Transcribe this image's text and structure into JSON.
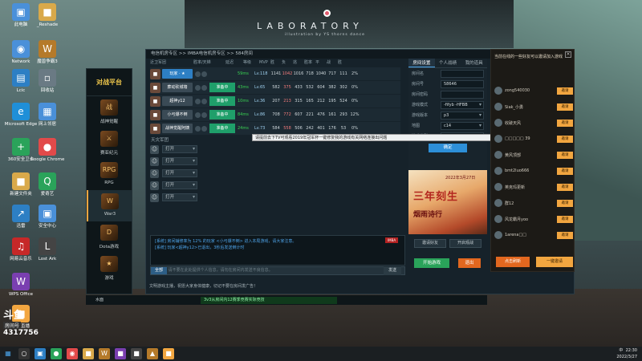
{
  "desktop": {
    "banner_title": "LABORATORY",
    "banner_subtitle": "illustration by YS thorns dance",
    "icons": [
      {
        "label": "此电脑",
        "glyph": "▣",
        "color": "#4a90d9"
      },
      {
        "label": "_Reshade",
        "glyph": "■",
        "color": "#d9a94a"
      },
      {
        "label": "Network",
        "glyph": "◉",
        "color": "#4a90d9"
      },
      {
        "label": "魔兽争霸3",
        "glyph": "W",
        "color": "#b57a2a"
      },
      {
        "label": "Lcic",
        "glyph": "▤",
        "color": "#2d7fc4"
      },
      {
        "label": "回收站",
        "glyph": "▫",
        "color": "#6a7a84"
      },
      {
        "label": "Microsoft Edge",
        "glyph": "e",
        "color": "#1f8fd8"
      },
      {
        "label": "网上邻居",
        "glyph": "▦",
        "color": "#4a90d9"
      },
      {
        "label": "360安全卫士",
        "glyph": "+",
        "color": "#2aa35a"
      },
      {
        "label": "Google Chrome",
        "glyph": "●",
        "color": "#e24a4a"
      },
      {
        "label": "新建文件夹",
        "glyph": "■",
        "color": "#d9a94a"
      },
      {
        "label": "爱奇艺",
        "glyph": "Q",
        "color": "#2aa35a"
      },
      {
        "label": "迅雷",
        "glyph": "↗",
        "color": "#2d7fc4"
      },
      {
        "label": "安全中心",
        "glyph": "▣",
        "color": "#4a90d9"
      },
      {
        "label": "网易云音乐",
        "glyph": "♫",
        "color": "#c62828"
      },
      {
        "label": "Lost Ark",
        "glyph": "L",
        "color": "#444"
      },
      {
        "label": "WPS Office",
        "glyph": "W",
        "color": "#7a3fb0"
      },
      {
        "label": "斗鱼直播",
        "glyph": "■",
        "color": "#f2a640"
      }
    ]
  },
  "sidebar": {
    "logo": "对战平台",
    "items": [
      {
        "label": "战神觉醒",
        "icon": "战"
      },
      {
        "label": "赛亚纪元",
        "icon": "⚔"
      },
      {
        "label": "RPG",
        "icon": "RPG"
      },
      {
        "label": "War3",
        "icon": "W"
      },
      {
        "label": "Dota游戏",
        "icon": "D"
      },
      {
        "label": "游戏",
        "icon": "★"
      }
    ]
  },
  "room": {
    "breadcrumb": "电信机房专区 >> IMBA电信机房专区 >> 584房间",
    "team1_label": "近卫军团",
    "team2_label": "天灾军团",
    "columns": [
      "近卫军团",
      "胜率/天梯",
      "延迟",
      "等级",
      "MVP",
      "胜",
      "负",
      "逃",
      "胜率",
      "平",
      "战",
      "胜"
    ],
    "players": [
      {
        "avatar": "■",
        "name": "玩家 · ★",
        "me": true,
        "badge": "",
        "ping": "59ms",
        "level": "Lv.118",
        "stats": [
          "1141",
          "1042",
          "1016",
          "718",
          "1040",
          "717",
          "111",
          "2%"
        ]
      },
      {
        "avatar": "■",
        "name": "葬动砍城墙",
        "me": false,
        "badge": "准备中",
        "ping": "43ms",
        "level": "Lv.65",
        "stats": [
          "582",
          "375",
          "433",
          "532",
          "604",
          "382",
          "302",
          "0%"
        ]
      },
      {
        "avatar": "■",
        "name": "超神y12",
        "me": false,
        "badge": "准备中",
        "ping": "10ms",
        "level": "Lv.36",
        "stats": [
          "207",
          "213",
          "315",
          "165",
          "212",
          "195",
          "524",
          "0%"
        ]
      },
      {
        "avatar": "■",
        "name": "小弓爆不倒",
        "me": false,
        "badge": "准备中",
        "ping": "84ms",
        "level": "Lv.86",
        "stats": [
          "708",
          "772",
          "607",
          "221",
          "476",
          "161",
          "293",
          "12%"
        ]
      },
      {
        "avatar": "■",
        "name": "战神觉醒阿姨",
        "me": false,
        "badge": "准备中",
        "ping": "24ms",
        "level": "Lv.73",
        "stats": [
          "584",
          "558",
          "506",
          "242",
          "401",
          "176",
          "53",
          "0%"
        ]
      }
    ],
    "slots": [
      {
        "value": "打开"
      },
      {
        "value": "打开"
      },
      {
        "value": "打开"
      },
      {
        "value": "打开"
      },
      {
        "value": "打开"
      }
    ]
  },
  "settings": {
    "tabs": [
      "房间设置",
      "个人战绩",
      "我的道具"
    ],
    "rows": [
      {
        "key": "房间名",
        "value": ""
      },
      {
        "key": "房间号",
        "value": "58646"
      },
      {
        "key": "房间密码",
        "value": ""
      },
      {
        "key": "游戏模式",
        "value": "-fifyb -HFBB"
      },
      {
        "key": "游戏版本",
        "value": "p3"
      },
      {
        "key": "地图",
        "value": "c14"
      },
      {
        "key": "游戏类型",
        "value": ""
      }
    ],
    "confirm": "确定",
    "tooltip": "请提前去下TV可观看2019年冠军杯一键修复我的游戏有关网络连接出问题",
    "ad_title": "三年刻生",
    "ad_sub": "烟雨诗行",
    "ad_date": "2022年3月27日",
    "btn_left": "邀请好友",
    "btn_right": "开启观战",
    "start": "开始游戏",
    "exit": "退出"
  },
  "chat": {
    "line1": "[系统] 房间辅修率为 12% 的玩家 <小弓爆不倒> 进入本局游戏，请大家注意。",
    "line2": "[系统] 玩家<超神y12>已退出，3秒后发送倒计时",
    "badge": "IMBA",
    "input_sel": "全部",
    "placeholder": "请不要在此处提供个人信息，请勿在房间内发送不良信息。",
    "send": "发送",
    "notice": "文明游戏主播，祝愿大家身体健康，切记不要在房间发广告！"
  },
  "invite": {
    "title": "当前在线的一些好友可以邀请加入游戏",
    "close": "×",
    "friends": [
      {
        "name": "zong540030",
        "btn": "邀请"
      },
      {
        "name": "Siak_小勇",
        "btn": "邀请"
      },
      {
        "name": "收破天风",
        "btn": "邀请"
      },
      {
        "name": "□□□□□ 39",
        "btn": "邀请"
      },
      {
        "name": "黄风顶部",
        "btn": "邀请"
      },
      {
        "name": "bmt2luo666",
        "btn": "邀请"
      },
      {
        "name": "英克玛更新",
        "btn": "邀请"
      },
      {
        "name": "群12",
        "btn": "邀请"
      },
      {
        "name": "风龙霸月yoo",
        "btn": "邀请"
      },
      {
        "name": "1arena□□",
        "btn": "邀请"
      }
    ],
    "refresh": "点击刷新",
    "invite_all": "一键邀请"
  },
  "appbar": {
    "user": "水面",
    "ticker": "3v3从房间内12赛季竞赛实际竞技"
  },
  "stream": {
    "logo": "斗鱼",
    "room_label": "房间号",
    "room_no": "4317756"
  },
  "taskbar": {
    "time": "22:30",
    "date": "2022/3/27",
    "lang": "中"
  }
}
